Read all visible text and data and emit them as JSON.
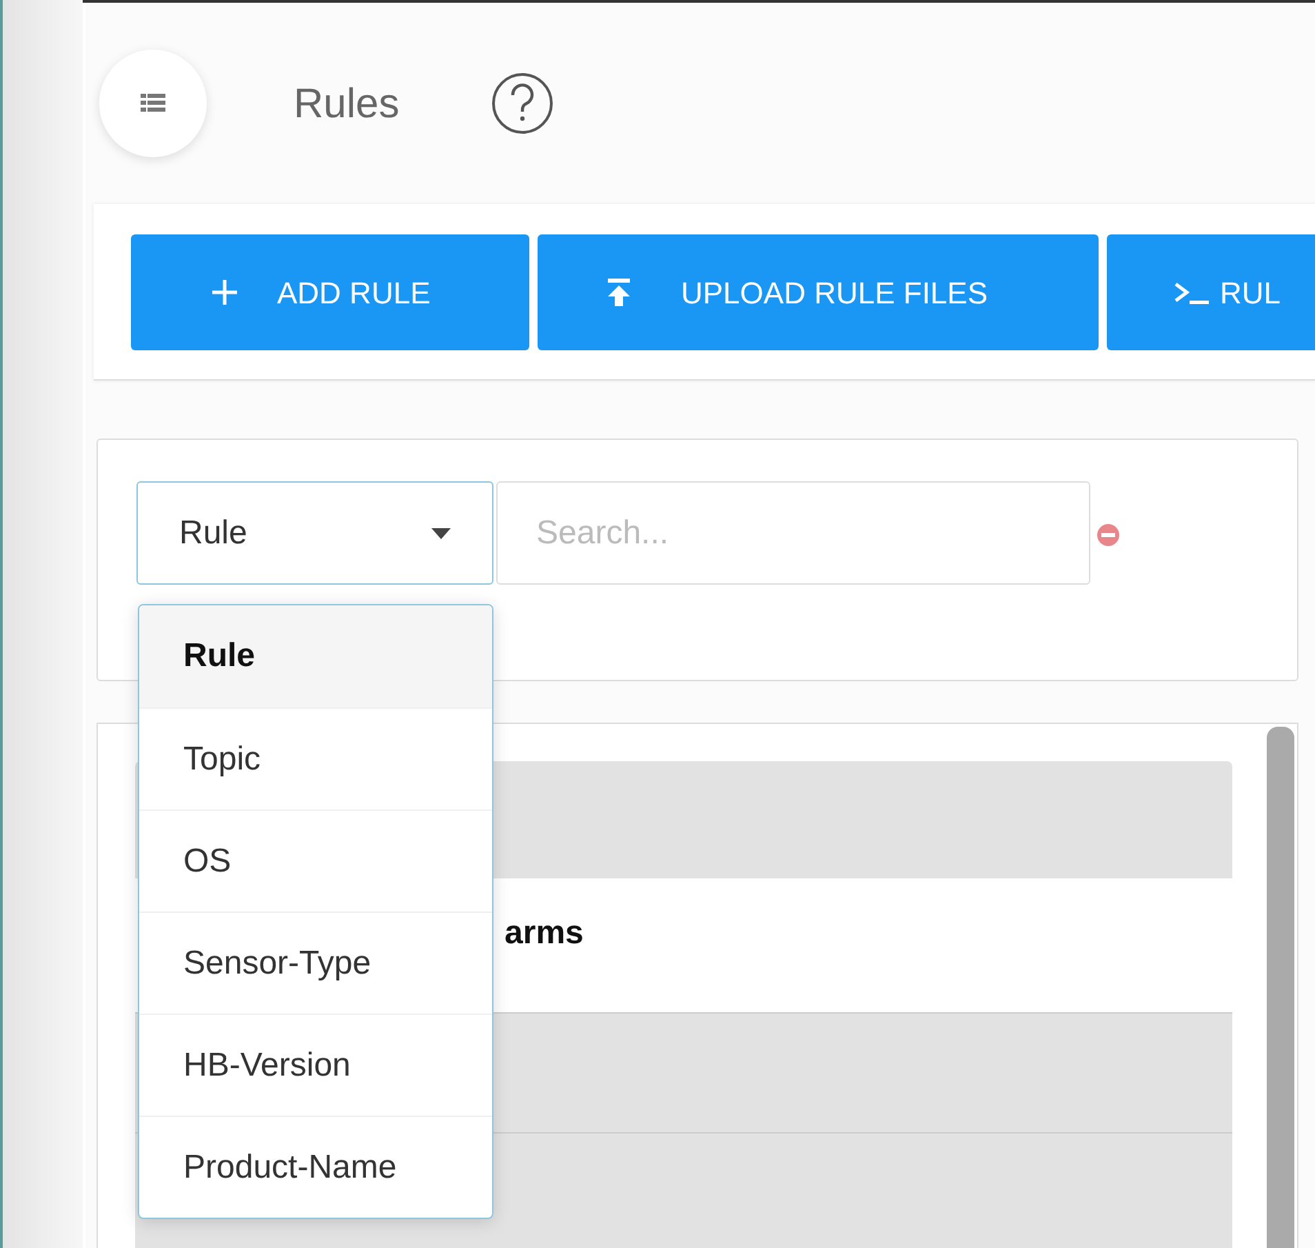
{
  "header": {
    "title": "Rules"
  },
  "toolbar": {
    "buttons": [
      {
        "label": "ADD RULE",
        "kind": "add"
      },
      {
        "label": "UPLOAD RULE FILES",
        "kind": "upload"
      },
      {
        "label": "RUL",
        "kind": "console"
      }
    ]
  },
  "filter": {
    "field": {
      "value": "Rule",
      "expanded": true
    },
    "search": {
      "placeholder": "Search..."
    },
    "options": [
      {
        "label": "Rule",
        "selected": true
      },
      {
        "label": "Topic",
        "selected": false
      },
      {
        "label": "OS",
        "selected": false
      },
      {
        "label": "Sensor-Type",
        "selected": false
      },
      {
        "label": "HB-Version",
        "selected": false
      },
      {
        "label": "Product-Name",
        "selected": false
      }
    ]
  },
  "table": {
    "rows": [
      {
        "text": "",
        "kind": "header"
      },
      {
        "text": "arms",
        "kind": "item"
      },
      {
        "text": "",
        "kind": "group"
      },
      {
        "text": "",
        "kind": "group"
      }
    ]
  }
}
